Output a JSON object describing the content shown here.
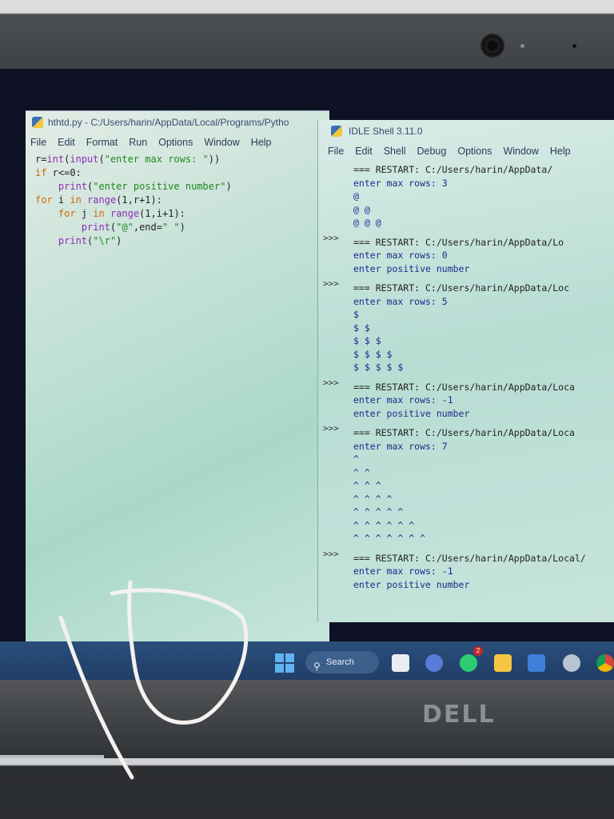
{
  "editor": {
    "title": "hthtd.py - C:/Users/harin/AppData/Local/Programs/Pytho",
    "menu": [
      "File",
      "Edit",
      "Format",
      "Run",
      "Options",
      "Window",
      "Help"
    ],
    "code": [
      [
        {
          "t": "r="
        },
        {
          "t": "int",
          "c": "bi"
        },
        {
          "t": "("
        },
        {
          "t": "input",
          "c": "bi"
        },
        {
          "t": "("
        },
        {
          "t": "\"enter max rows: \"",
          "c": "st"
        },
        {
          "t": "))"
        }
      ],
      [
        {
          "t": "if",
          "c": "kw"
        },
        {
          "t": " r<=0:"
        }
      ],
      [
        {
          "t": "    "
        },
        {
          "t": "print",
          "c": "bi"
        },
        {
          "t": "("
        },
        {
          "t": "\"enter positive number\"",
          "c": "st"
        },
        {
          "t": ")"
        }
      ],
      [
        {
          "t": "for",
          "c": "kw"
        },
        {
          "t": " i "
        },
        {
          "t": "in",
          "c": "kw"
        },
        {
          "t": " "
        },
        {
          "t": "range",
          "c": "bi"
        },
        {
          "t": "(1,r+1):"
        }
      ],
      [
        {
          "t": "    "
        },
        {
          "t": "for",
          "c": "kw"
        },
        {
          "t": " j "
        },
        {
          "t": "in",
          "c": "kw"
        },
        {
          "t": " "
        },
        {
          "t": "range",
          "c": "bi"
        },
        {
          "t": "(1,i+1):"
        }
      ],
      [
        {
          "t": "        "
        },
        {
          "t": "print",
          "c": "bi"
        },
        {
          "t": "("
        },
        {
          "t": "\"@\"",
          "c": "st"
        },
        {
          "t": ",end="
        },
        {
          "t": "\" \"",
          "c": "st"
        },
        {
          "t": ")"
        }
      ],
      [
        {
          "t": "    "
        },
        {
          "t": "print",
          "c": "bi"
        },
        {
          "t": "("
        },
        {
          "t": "\"\\r\"",
          "c": "st"
        },
        {
          "t": ")"
        }
      ]
    ]
  },
  "shell": {
    "title": "IDLE Shell 3.11.0",
    "menu": [
      "File",
      "Edit",
      "Shell",
      "Debug",
      "Options",
      "Window",
      "Help"
    ],
    "prompt": ">>>",
    "lines": [
      {
        "t": "=== RESTART: C:/Users/harin/AppData/",
        "c": "restart"
      },
      {
        "t": "enter max rows: 3"
      },
      {
        "t": "@"
      },
      {
        "t": "@ @"
      },
      {
        "t": "@ @ @"
      },
      {
        "t": "",
        "c": "gap",
        "prompt": true
      },
      {
        "t": "=== RESTART: C:/Users/harin/AppData/Lo",
        "c": "restart"
      },
      {
        "t": "enter max rows: 0"
      },
      {
        "t": "enter positive number"
      },
      {
        "t": "",
        "c": "gap",
        "prompt": true
      },
      {
        "t": "=== RESTART: C:/Users/harin/AppData/Loc",
        "c": "restart"
      },
      {
        "t": "enter max rows: 5"
      },
      {
        "t": "$"
      },
      {
        "t": "$ $"
      },
      {
        "t": "$ $ $"
      },
      {
        "t": "$ $ $ $"
      },
      {
        "t": "$ $ $ $ $"
      },
      {
        "t": "",
        "c": "gap",
        "prompt": true
      },
      {
        "t": "=== RESTART: C:/Users/harin/AppData/Loca",
        "c": "restart"
      },
      {
        "t": "enter max rows: -1"
      },
      {
        "t": "enter positive number"
      },
      {
        "t": "",
        "c": "gap",
        "prompt": true
      },
      {
        "t": "=== RESTART: C:/Users/harin/AppData/Loca",
        "c": "restart"
      },
      {
        "t": "enter max rows: 7"
      },
      {
        "t": "^"
      },
      {
        "t": "^ ^"
      },
      {
        "t": "^ ^ ^"
      },
      {
        "t": "^ ^ ^ ^"
      },
      {
        "t": "^ ^ ^ ^ ^"
      },
      {
        "t": "^ ^ ^ ^ ^ ^"
      },
      {
        "t": "^ ^ ^ ^ ^ ^ ^"
      },
      {
        "t": "",
        "c": "gap",
        "prompt": true
      },
      {
        "t": "=== RESTART: C:/Users/harin/AppData/Local/",
        "c": "restart"
      },
      {
        "t": "enter max rows: -1"
      },
      {
        "t": "enter positive number"
      }
    ]
  },
  "taskbar": {
    "search_label": "Search",
    "whatsapp_badge": "2",
    "icons": [
      "file-explorer-icon",
      "meet-icon",
      "whatsapp-icon",
      "folder-icon",
      "store-icon",
      "settings-icon",
      "chrome-icon"
    ]
  },
  "brand": "DELL",
  "colors": {
    "keyword": "#d06a00",
    "builtin": "#8e2cb6",
    "string": "#1e8a1e",
    "shell_output": "#1c2a8c",
    "taskbar": "#1f3c66"
  }
}
